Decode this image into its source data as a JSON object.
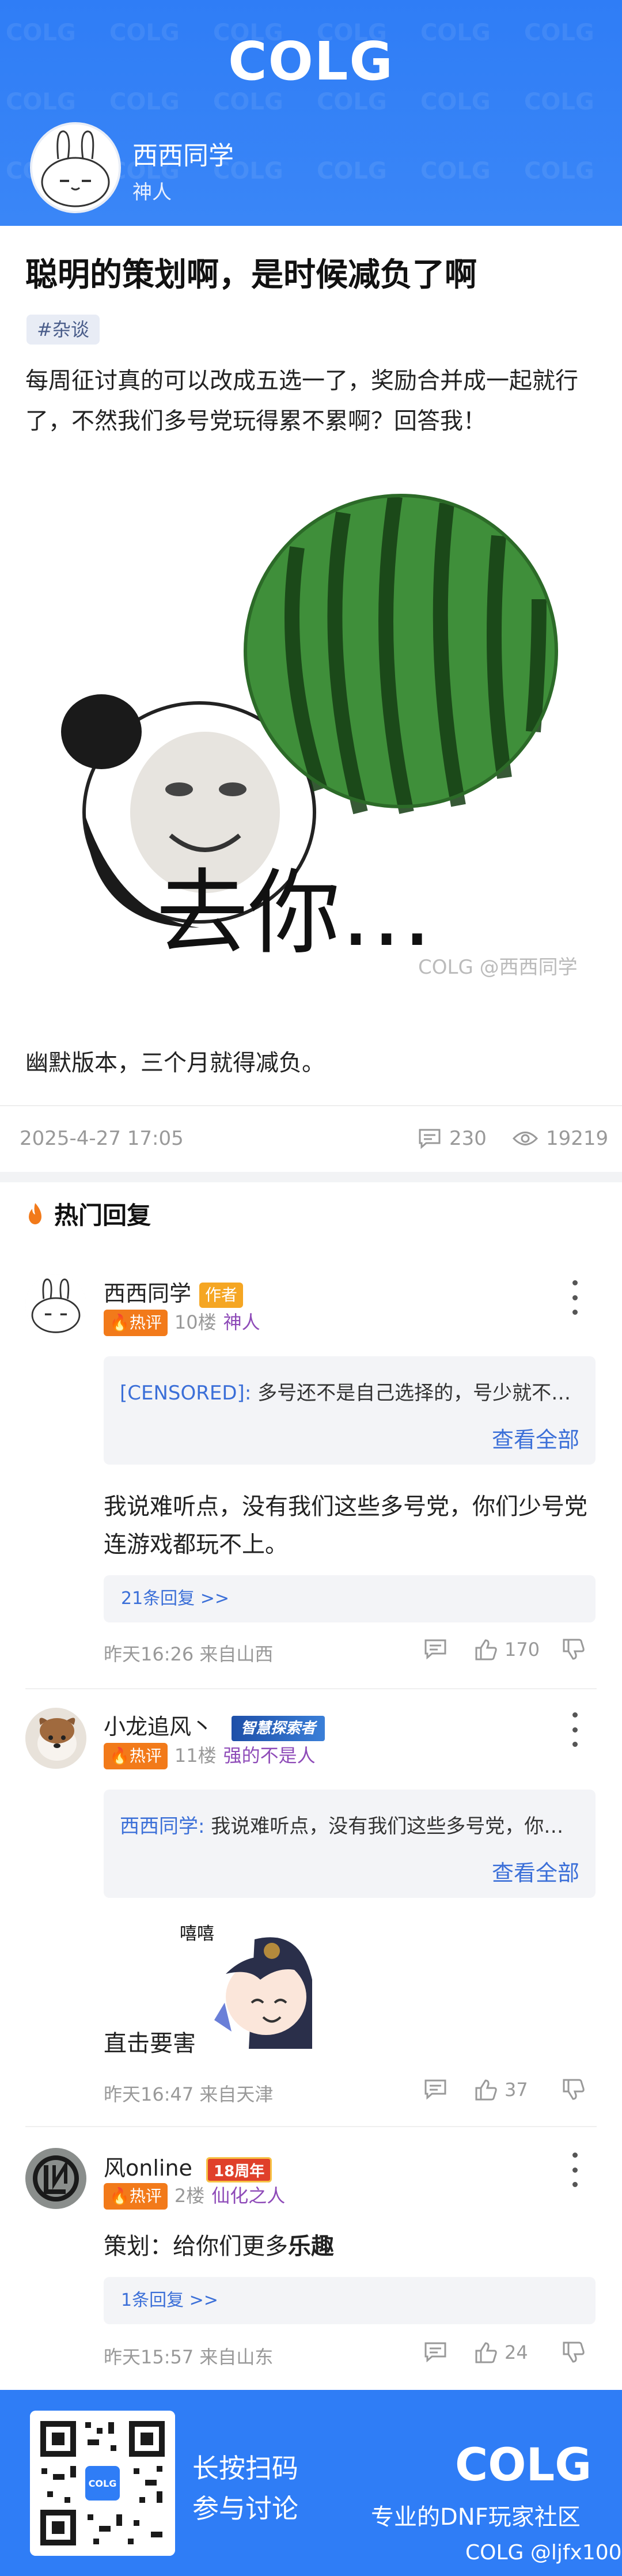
{
  "header": {
    "logo": "COLG",
    "author_name": "西西同学",
    "author_title": "神人"
  },
  "post": {
    "title": "聪明的策划啊，是时候减负了啊",
    "tag": "#杂谈",
    "body": "每周征讨真的可以改成五选一了，奖励合并成一起就行了，不然我们多号党玩得累不累啊？回答我！",
    "meme_caption": "去你…",
    "meme_watermark": "COLG @西西同学",
    "closing": "幽默版本，三个月就得减负。",
    "date": "2025-4-27 17:05",
    "comment_count": "230",
    "view_count": "19219"
  },
  "hot_replies": {
    "heading": "热门回复",
    "hot_badge": "🔥热评",
    "quote_all": "查看全部",
    "items": [
      {
        "name": "西西同学",
        "author_badge": "作者",
        "floor": "10楼",
        "level": "神人",
        "quote_name": "[CENSORED]:",
        "quote_text": "多号还不是自己选择的，号少就不累。",
        "text": "我说难听点，没有我们这些多号党，你们少号党连游戏都玩不上。",
        "sub_replies": "21条回复 >>",
        "time_place": "昨天16:26 来自山西",
        "likes": "170"
      },
      {
        "name": "小龙追风丶",
        "medal": "智慧探索者",
        "floor": "11楼",
        "level": "强的不是人",
        "quote_name": "西西同学:",
        "quote_text": "我说难听点，没有我们这些多号党，你们…",
        "text": "直击要害",
        "sticker_text": "嘻嘻",
        "time_place": "昨天16:47 来自天津",
        "likes": "37"
      },
      {
        "name": "风online",
        "medal": "18周年",
        "floor": "2楼",
        "level": "仙化之人",
        "text_prefix": "策划：给你们更多",
        "text_bold": "乐趣",
        "sub_replies": "1条回复 >>",
        "time_place": "昨天15:57 来自山东",
        "likes": "24"
      }
    ]
  },
  "footer": {
    "line1": "长按扫码",
    "line2": "参与讨论",
    "logo": "COLG",
    "slogan": "专业的DNF玩家社区",
    "credit": "COLG @ljfx100",
    "qr_logo": "COLG"
  },
  "colors": {
    "brand_blue": "#2f7df6",
    "hot_orange": "#f27a1a",
    "author_badge": "#f5a623",
    "link_blue": "#3b6fd8",
    "level_purple": "#8e4bb8"
  }
}
